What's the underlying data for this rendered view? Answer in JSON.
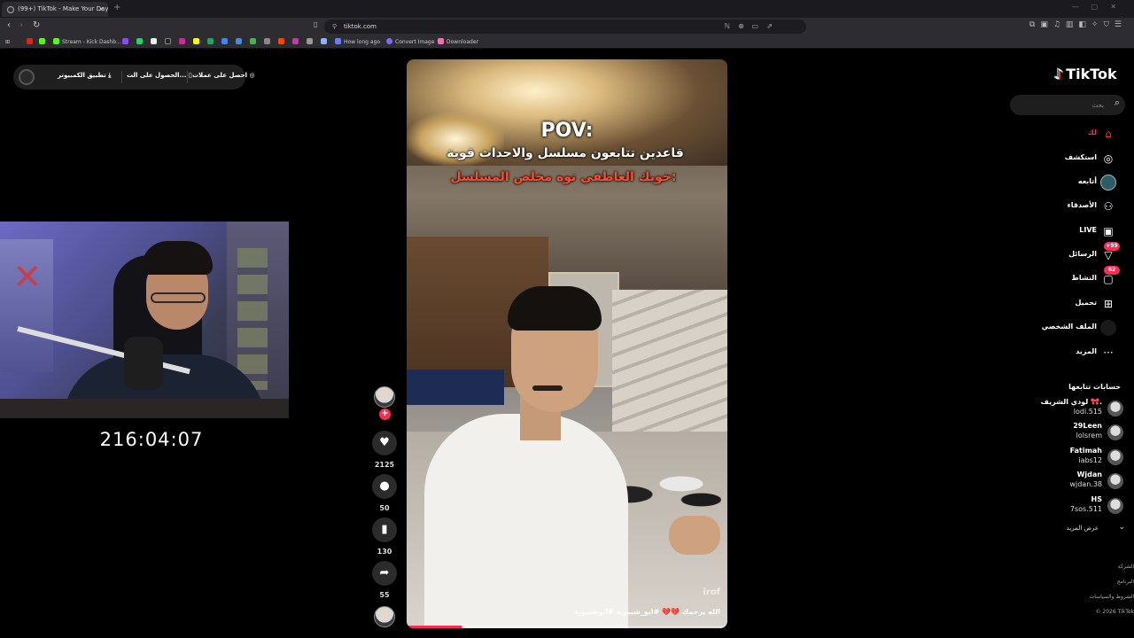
{
  "browser": {
    "tab_title": "(99+) TikTok - Make Your Day",
    "url": "tiktok.com",
    "bookmarks": [
      {
        "label": "Stream - Kick Dashb...",
        "color": "#53fc18"
      },
      {
        "label": "How long ago",
        "color": "#6b7bff"
      },
      {
        "label": "Convert Image",
        "color": "#7b6bff"
      },
      {
        "label": "Downloader",
        "color": "#ff6bb0"
      }
    ]
  },
  "topbar": {
    "get_coins": "احصل على عملات",
    "get_app": "الحصول على الت...",
    "desktop_app": "تطبيق الكمبيوتر"
  },
  "stream": {
    "timer": "216:04:07"
  },
  "video": {
    "caption_title": "POV:",
    "caption_line1": "قاعدين تتابعون مسلسل والاحداث قوية",
    "caption_line2": "خويك العاطفي توه مخلص المسلسل:",
    "watermark": "irof",
    "description": "الله يرحمك 💔💔 #ابو_شيبوبه #ابوشيبوبه",
    "progress": 0.17
  },
  "actions": {
    "likes": "2125",
    "comments": "50",
    "saves": "130",
    "shares": "55"
  },
  "sidebar": {
    "logo": "TikTok",
    "search_placeholder": "بحث",
    "nav": [
      {
        "label": "لك",
        "icon": "home-icon"
      },
      {
        "label": "استكشف",
        "icon": "compass-icon"
      },
      {
        "label": "أتابعه",
        "icon": "following-avatar-icon"
      },
      {
        "label": "الأصدقاء",
        "icon": "friends-icon"
      },
      {
        "label": "LIVE",
        "icon": "live-icon"
      },
      {
        "label": "الرسائل",
        "icon": "messages-icon",
        "badge": "+99"
      },
      {
        "label": "النشاط",
        "icon": "activity-icon",
        "badge": "62"
      },
      {
        "label": "تحميل",
        "icon": "upload-icon"
      },
      {
        "label": "الملف الشخصي",
        "icon": "profile-icon"
      },
      {
        "label": "المزيد",
        "icon": "more-icon"
      }
    ],
    "following_title": "حسابات تتابعها",
    "accounts": [
      {
        "name": "لودي الشريف 🎀.",
        "handle": "lodi.515"
      },
      {
        "name": "29Leen",
        "handle": "lolsrem"
      },
      {
        "name": "Fatimah",
        "handle": "iabs12"
      },
      {
        "name": "Wjdan",
        "handle": "wjdan.38"
      },
      {
        "name": "HS",
        "handle": "7sos.511"
      }
    ],
    "see_more": "عرض المزيد",
    "footer": [
      "الشركة",
      "البرنامج",
      "الشروط والسياسات",
      "© 2026 TikTok"
    ],
    "accent": "#fe2c55"
  }
}
